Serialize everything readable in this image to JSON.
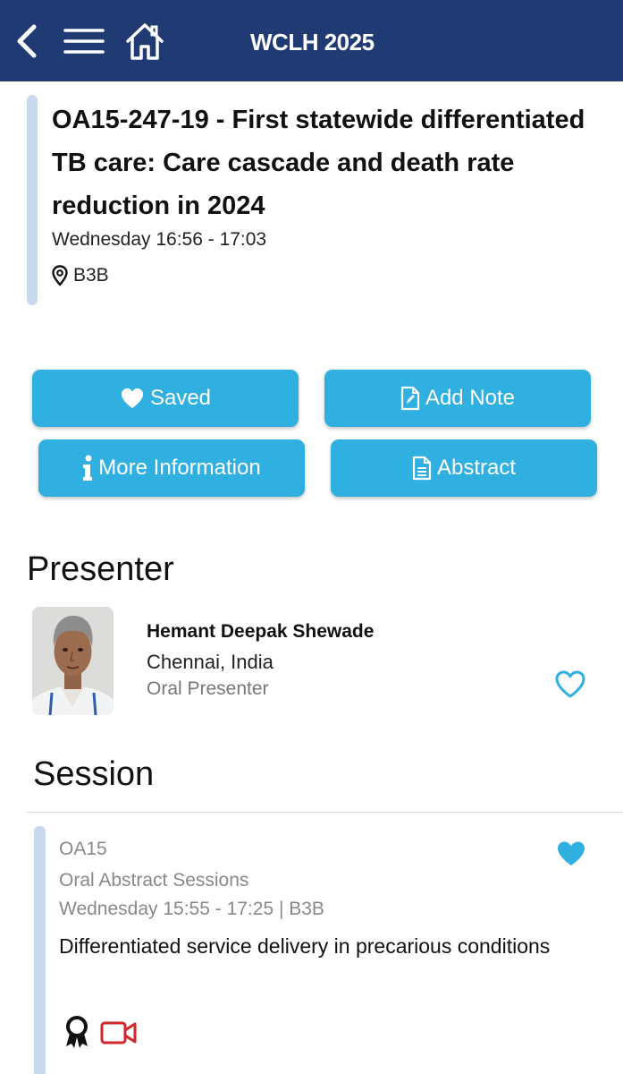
{
  "header": {
    "title": "WCLH 2025",
    "back_icon": "chevron-left-icon",
    "menu_icon": "hamburger-menu-icon",
    "home_icon": "home-icon",
    "background_color": "#203a74"
  },
  "abstract": {
    "title": "OA15-247-19 - First statewide differentiated TB care: Care cascade and death rate reduction in 2024",
    "time": "Wednesday 16:56 - 17:03",
    "location": "B3B",
    "location_icon": "map-pin-icon"
  },
  "actions": {
    "saved_label": "Saved",
    "saved_icon": "heart-filled-icon",
    "add_note_label": "Add Note",
    "add_note_icon": "edit-document-icon",
    "more_info_label": "More Information",
    "more_info_icon": "info-icon",
    "abstract_label": "Abstract",
    "abstract_icon": "document-icon",
    "button_color": "#2fb0e0"
  },
  "presenter": {
    "heading": "Presenter",
    "name": "Hemant Deepak Shewade",
    "place": "Chennai, India",
    "role": "Oral Presenter",
    "favorite_icon": "heart-outline-icon"
  },
  "session": {
    "heading": "Session",
    "code": "OA15",
    "type": "Oral Abstract Sessions",
    "time_location": "Wednesday 15:55 - 17:25 | B3B",
    "title": "Differentiated service delivery in precarious conditions",
    "favorite_icon": "heart-filled-icon",
    "award_icon": "award-ribbon-icon",
    "video_icon": "video-camera-icon"
  }
}
